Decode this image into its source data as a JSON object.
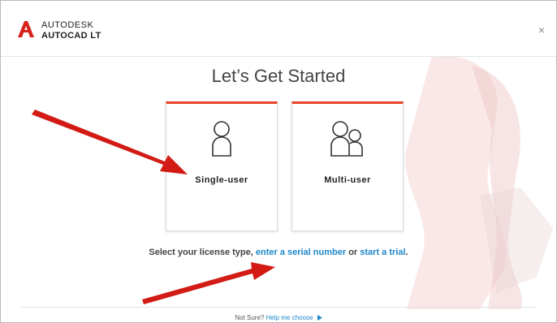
{
  "brand": {
    "line1": "AUTODESK",
    "line2": "AUTOCAD LT"
  },
  "header": {
    "close": "×"
  },
  "title": "Let’s Get Started",
  "cards": {
    "single": "Single-user",
    "multi": "Multi-user"
  },
  "prompt": {
    "text": "Select your license type, ",
    "link1": "enter a serial number",
    "mid": " or ",
    "link2": "start a trial",
    "end": "."
  },
  "footer": {
    "text": "Not Sure? ",
    "link": "Help me choose"
  },
  "colors": {
    "accent": "#e8452c",
    "link": "#1e87c9",
    "arrow": "#d11b14"
  }
}
